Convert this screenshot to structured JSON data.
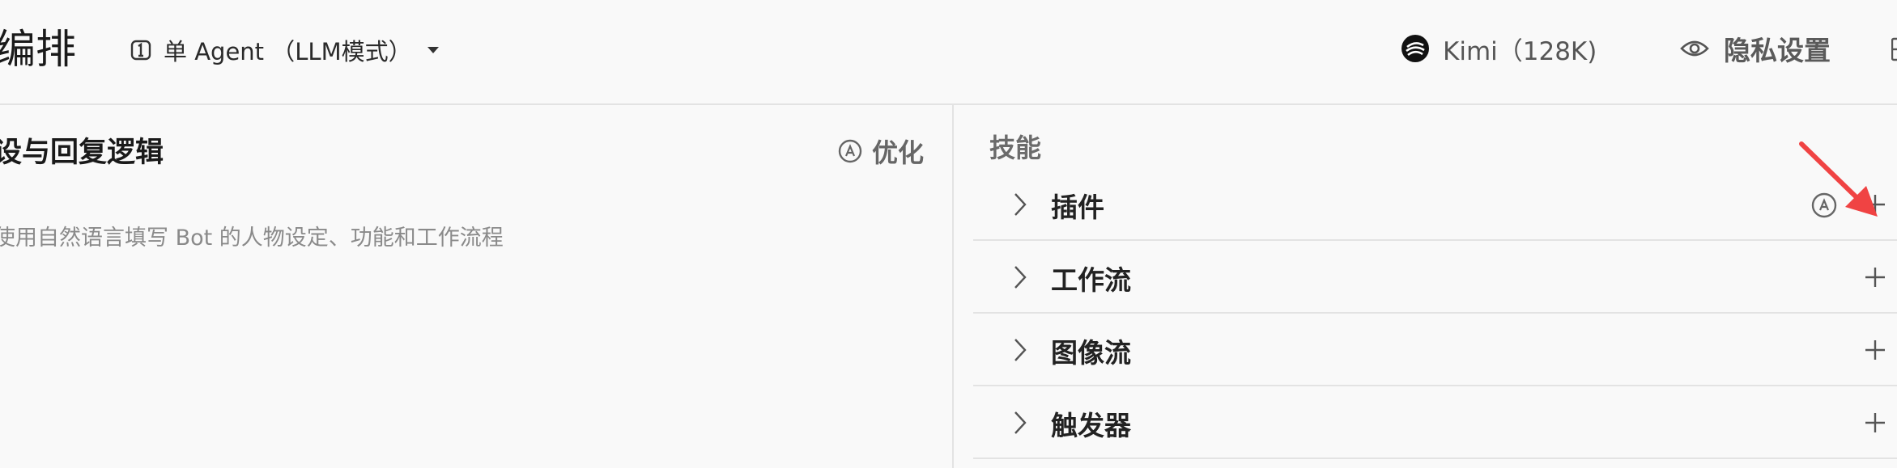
{
  "header": {
    "page_title": "编排",
    "mode_selector": {
      "label": "单 Agent （LLM模式）",
      "icon": "agent-mode-icon"
    },
    "model_selector": {
      "label": "Kimi（128K)",
      "icon": "kimi-logo-icon"
    },
    "privacy_button": {
      "label": "隐私设置",
      "icon": "eye-icon"
    }
  },
  "prompt_panel": {
    "title": "设与回复逻辑",
    "optimize_label": "优化",
    "placeholder": "使用自然语言填写 Bot 的人物设定、功能和工作流程"
  },
  "skills_panel": {
    "heading": "技能",
    "items": [
      {
        "label": "插件",
        "has_auto_icon": true
      },
      {
        "label": "工作流",
        "has_auto_icon": false
      },
      {
        "label": "图像流",
        "has_auto_icon": false
      },
      {
        "label": "触发器",
        "has_auto_icon": false
      }
    ]
  },
  "colors": {
    "annotation_arrow": "#f04343",
    "divider": "#e3e3e3",
    "background": "#f9f9f9"
  }
}
